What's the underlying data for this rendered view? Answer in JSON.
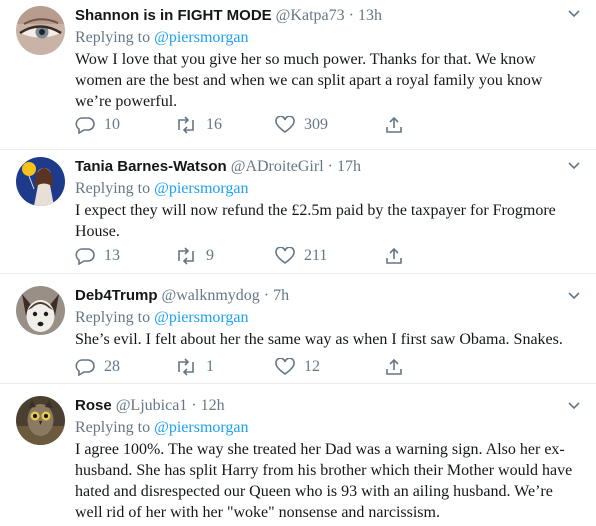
{
  "tweets": [
    {
      "name": "Shannon is in FIGHT MODE",
      "handle": "@Katpa73",
      "dot": "·",
      "time": "13h",
      "replying_prefix": "Replying to",
      "replying_to": "@piersmorgan",
      "text": "Wow I love that you give her so much power. Thanks for that.  We know women are the best and when we can split apart a royal family you know we’re powerful.",
      "replies": "10",
      "retweets": "16",
      "likes": "309",
      "avatar_icon": "eye-closeup-avatar"
    },
    {
      "name": "Tania Barnes-Watson",
      "handle": "@ADroiteGirl",
      "dot": "·",
      "time": "17h",
      "replying_prefix": "Replying to",
      "replying_to": "@piersmorgan",
      "text": "I expect they will now refund the £2.5m paid by the taxpayer for Frogmore House.",
      "replies": "13",
      "retweets": "9",
      "likes": "211",
      "avatar_icon": "woman-with-balloon-avatar"
    },
    {
      "name": "Deb4Trump",
      "handle": "@walknmydog",
      "dot": "·",
      "time": "7h",
      "replying_prefix": "Replying to",
      "replying_to": "@piersmorgan",
      "text": "She’s evil. I felt about her the same way as when I first saw Obama. Snakes.",
      "replies": "28",
      "retweets": "1",
      "likes": "12",
      "avatar_icon": "dog-avatar"
    },
    {
      "name": "Rose",
      "handle": "@Ljubica1",
      "dot": "·",
      "time": "12h",
      "replying_prefix": "Replying to",
      "replying_to": "@piersmorgan",
      "text": "I agree 100%.  The way she treated her Dad was a warning sign. Also her ex-husband. She has split Harry from his brother which their Mother would have hated and disrespected our Queen who is 93 with an ailing husband. We’re well rid of her with her \"woke\" nonsense and narcissism.",
      "replies": "",
      "retweets": "",
      "likes": "",
      "avatar_icon": "owl-avatar"
    }
  ],
  "colors": {
    "link": "#1da1f2",
    "muted": "#657786",
    "text": "#14171a",
    "divider": "#e6ecf0"
  }
}
